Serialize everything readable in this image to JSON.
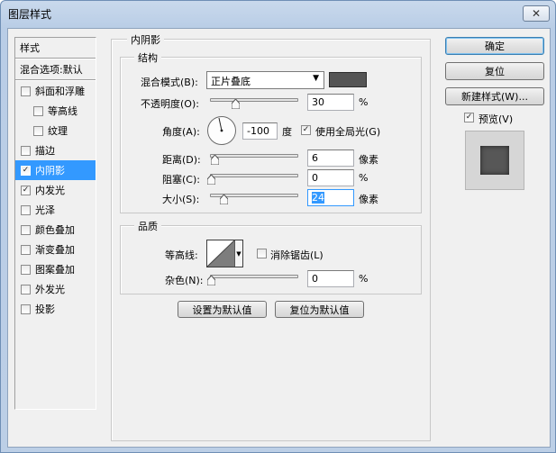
{
  "window": {
    "title": "图层样式",
    "close_label": "✕"
  },
  "left_panel": {
    "header_style": "样式",
    "header_blend": "混合选项:默认",
    "items": [
      {
        "label": "斜面和浮雕",
        "checked": false
      },
      {
        "label": "等高线",
        "checked": false
      },
      {
        "label": "纹理",
        "checked": false
      },
      {
        "label": "描边",
        "checked": false
      },
      {
        "label": "内阴影",
        "checked": true
      },
      {
        "label": "内发光",
        "checked": true
      },
      {
        "label": "光泽",
        "checked": false
      },
      {
        "label": "颜色叠加",
        "checked": false
      },
      {
        "label": "渐变叠加",
        "checked": false
      },
      {
        "label": "图案叠加",
        "checked": false
      },
      {
        "label": "外发光",
        "checked": false
      },
      {
        "label": "投影",
        "checked": false
      }
    ]
  },
  "inner_shadow": {
    "section_title": "内阴影",
    "structure_title": "结构",
    "blend_mode_label": "混合模式(B):",
    "blend_mode_value": "正片叠底",
    "shadow_color": "#555555",
    "opacity_label": "不透明度(O):",
    "opacity_value": "30",
    "percent": "%",
    "angle_label": "角度(A):",
    "angle_value": "-100",
    "degree": "度",
    "global_light_label": "使用全局光(G)",
    "global_light_checked": true,
    "distance_label": "距离(D):",
    "distance_value": "6",
    "choke_label": "阻塞(C):",
    "choke_value": "0",
    "size_label": "大小(S):",
    "size_value": "24",
    "pixels": "像素",
    "quality_title": "品质",
    "contour_label": "等高线:",
    "antialias_label": "消除锯齿(L)",
    "antialias_checked": false,
    "noise_label": "杂色(N):",
    "noise_value": "0",
    "make_default_button": "设置为默认值",
    "reset_default_button": "复位为默认值"
  },
  "actions": {
    "ok": "确定",
    "reset": "复位",
    "new_style": "新建样式(W)...",
    "preview_label": "预览(V)",
    "preview_checked": true
  },
  "colors": {
    "selection": "#3399ff",
    "title_bar": "#bccfe6"
  }
}
